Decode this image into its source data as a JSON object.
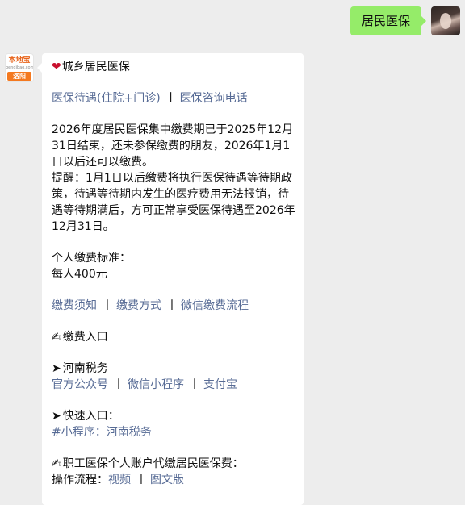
{
  "user_message": {
    "text": "居民医保"
  },
  "bot": {
    "logo": {
      "top": "本地宝",
      "mid": "bendibao.com",
      "city": "洛阳"
    },
    "heart_icon": "❤",
    "title": "城乡居民医保",
    "links_row1": [
      "医保待遇(住院+门诊)",
      "医保咨询电话"
    ],
    "para1": [
      "2026年度居民医保集中缴费期已于2025年12月",
      "31日结束，还未参保缴费的朋友，2026年1月1",
      "日以后还可以缴费。"
    ],
    "para2": [
      "提醒：1月1日以后缴费将执行医保待遇等待期政",
      "策，待遇等待期内发生的医疗费用无法报销，待",
      "遇等待期满后，方可正常享受医保待遇至2026年",
      "12月31日。"
    ],
    "standard_label": "个人缴费标准：",
    "standard_value": "每人400元",
    "links_row2": [
      "缴费须知",
      "缴费方式",
      "微信缴费流程"
    ],
    "pay_entry_icon": "✍",
    "pay_entry": "缴费入口",
    "arrow_icon": "➤",
    "henan_tax": "河南税务",
    "links_row3": [
      "官方公众号",
      "微信小程序",
      "支付宝"
    ],
    "quick_entry": "快速入口：",
    "quick_link": "#小程序：河南税务",
    "employee_title": "职工医保个人账户代缴居民医保费：",
    "process_label": "操作流程：",
    "process_links": [
      "视频",
      "图文版"
    ],
    "separator": "丨"
  }
}
